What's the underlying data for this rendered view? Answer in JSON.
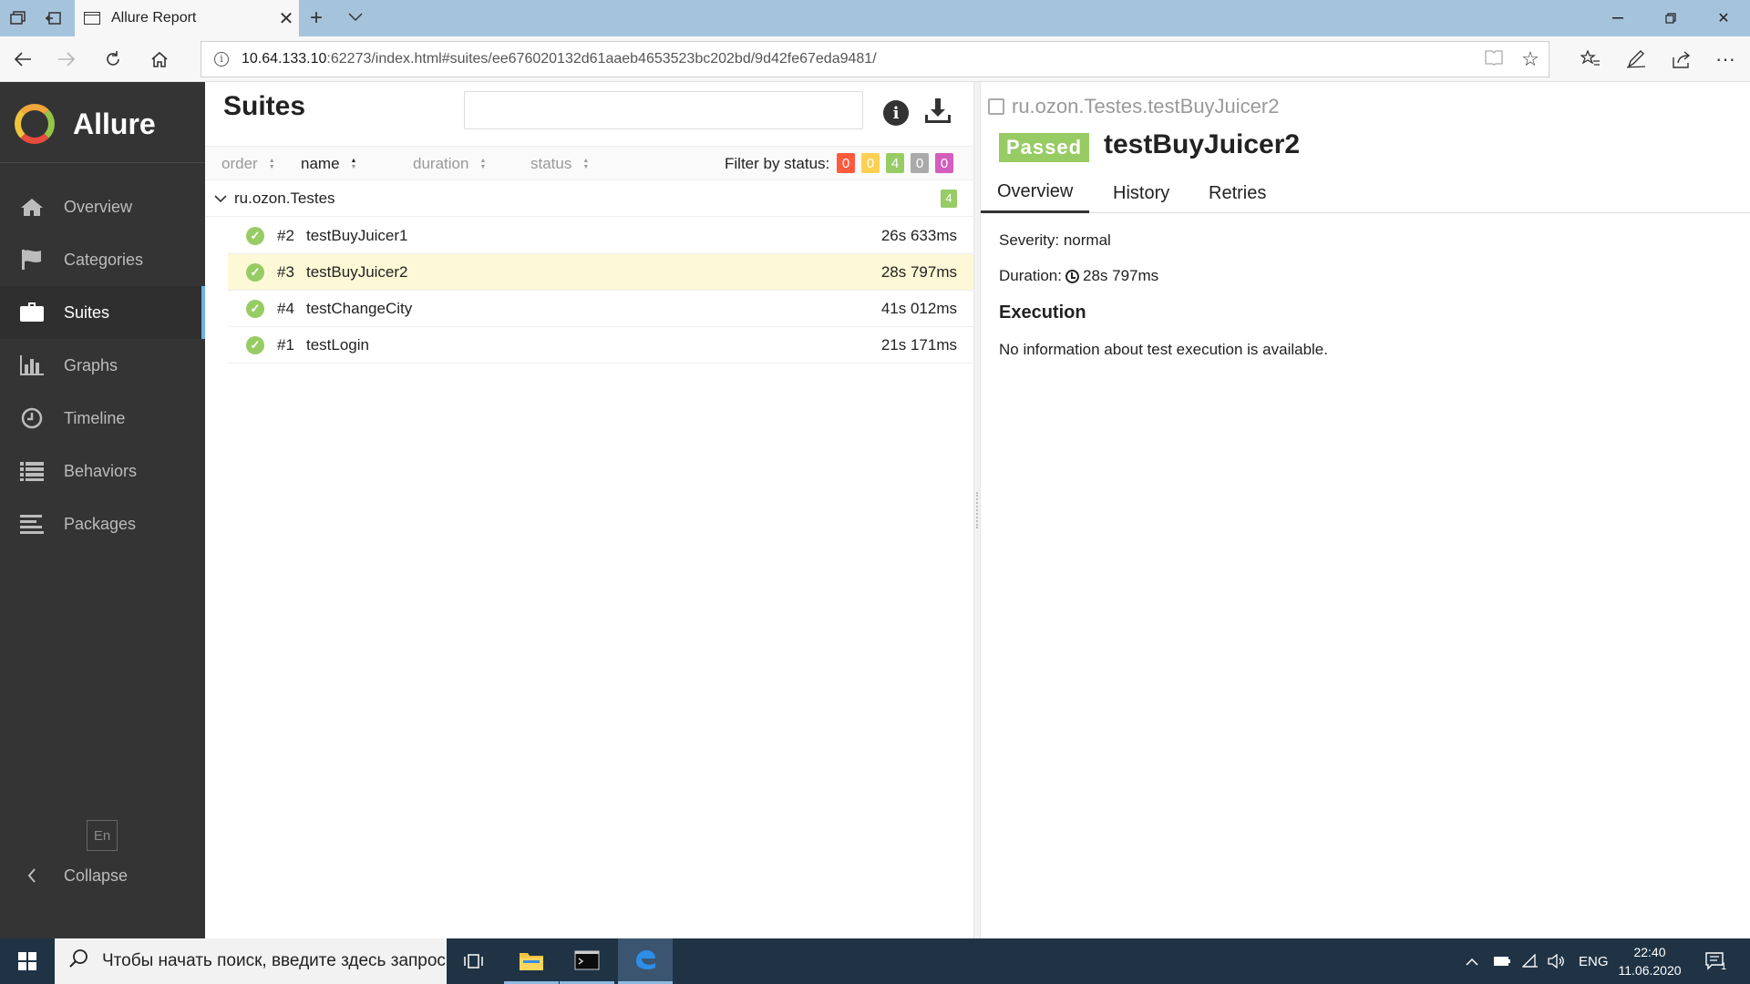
{
  "browser": {
    "tab_title": "Allure Report",
    "url_host": "10.64.133.10",
    "url_rest": ":62273/index.html#suites/ee676020132d61aaeb4653523bc202bd/9d42fe67eda9481/"
  },
  "sidebar": {
    "brand": "Allure",
    "items": [
      {
        "label": "Overview",
        "icon": "home-icon"
      },
      {
        "label": "Categories",
        "icon": "flag-icon"
      },
      {
        "label": "Suites",
        "icon": "briefcase-icon",
        "active": true
      },
      {
        "label": "Graphs",
        "icon": "bar-chart-icon"
      },
      {
        "label": "Timeline",
        "icon": "clock-icon"
      },
      {
        "label": "Behaviors",
        "icon": "list-icon"
      },
      {
        "label": "Packages",
        "icon": "align-left-icon"
      }
    ],
    "language": "En",
    "collapse_label": "Collapse"
  },
  "suites": {
    "title": "Suites",
    "search_placeholder": "",
    "sort": {
      "order": "order",
      "name": "name",
      "duration": "duration",
      "status": "status"
    },
    "filter_label": "Filter by status:",
    "status_counts": [
      {
        "status": "failed",
        "count": "0",
        "color": "#fd5a3e"
      },
      {
        "status": "broken",
        "count": "0",
        "color": "#ffd050"
      },
      {
        "status": "passed",
        "count": "4",
        "color": "#97cc64"
      },
      {
        "status": "skipped",
        "count": "0",
        "color": "#aaaaaa"
      },
      {
        "status": "unknown",
        "count": "0",
        "color": "#d35ebe"
      }
    ],
    "group": {
      "name": "ru.ozon.Testes",
      "count": "4"
    },
    "tests": [
      {
        "num": "#2",
        "name": "testBuyJuicer1",
        "duration": "26s 633ms"
      },
      {
        "num": "#3",
        "name": "testBuyJuicer2",
        "duration": "28s 797ms",
        "selected": true
      },
      {
        "num": "#4",
        "name": "testChangeCity",
        "duration": "41s 012ms"
      },
      {
        "num": "#1",
        "name": "testLogin",
        "duration": "21s 171ms"
      }
    ]
  },
  "detail": {
    "breadcrumb": "ru.ozon.Testes.testBuyJuicer2",
    "status": "Passed",
    "title": "testBuyJuicer2",
    "tabs": [
      "Overview",
      "History",
      "Retries"
    ],
    "severity": "Severity: normal",
    "duration_label": "Duration:",
    "duration_value": "28s 797ms",
    "execution_heading": "Execution",
    "execution_message": "No information about test execution is available."
  },
  "taskbar": {
    "search_placeholder": "Чтобы начать поиск, введите здесь запрос",
    "language": "ENG",
    "time": "22:40",
    "date": "11.06.2020",
    "notifications": "1"
  }
}
